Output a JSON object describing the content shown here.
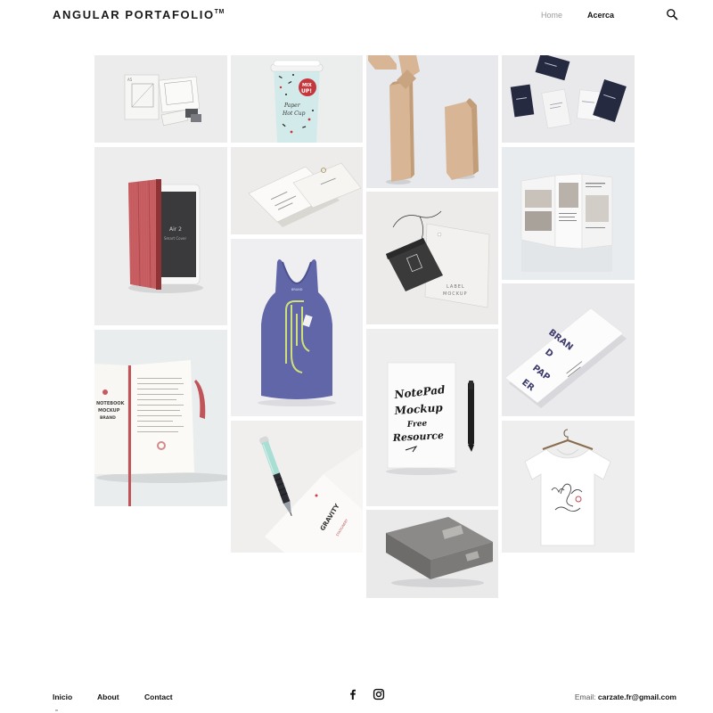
{
  "header": {
    "logo": "ANGULAR PORTAFOLIO",
    "logo_mark": "TM",
    "nav": [
      {
        "label": "Home",
        "active": false
      },
      {
        "label": "Acerca",
        "active": true
      }
    ],
    "search_icon": "search-icon"
  },
  "gallery": {
    "tiles": [
      {
        "name": "stationery-mockup",
        "label": "A5"
      },
      {
        "name": "paper-cup-mockup",
        "label": "MIX UP! Paper Hot Cup"
      },
      {
        "name": "wood-blocks"
      },
      {
        "name": "dark-business-cards",
        "label": "GRAVITY"
      },
      {
        "name": "tablet-cover-mockup",
        "label": "Air 2 Smart Cover"
      },
      {
        "name": "business-cards-mockup",
        "label": "BUSINESS CARD"
      },
      {
        "name": "hang-tag-mockup",
        "label": "LABEL MOCKUP"
      },
      {
        "name": "brochure-mockup"
      },
      {
        "name": "tank-top-mockup"
      },
      {
        "name": "brand-paper-mockup",
        "label": "BRAND PAPER"
      },
      {
        "name": "notebook-mockup",
        "label": "NOTEBOOK MOCKUP BRAND"
      },
      {
        "name": "notepad-mockup",
        "label": "NotePad Mockup Free Resource"
      },
      {
        "name": "pen-stationery-mockup",
        "label": "GRAVITY STATIONERY"
      },
      {
        "name": "tshirt-mockup"
      },
      {
        "name": "box-mockup"
      }
    ]
  },
  "footer": {
    "links": [
      "Inicio",
      "About",
      "Contact"
    ],
    "social": [
      "facebook-icon",
      "instagram-icon"
    ],
    "email_label": "Email:",
    "email": "carzate.fr@gmail.com"
  },
  "colors": {
    "text": "#111111",
    "muted": "#9a9a9a",
    "tile_bg": "#eeeeee"
  }
}
